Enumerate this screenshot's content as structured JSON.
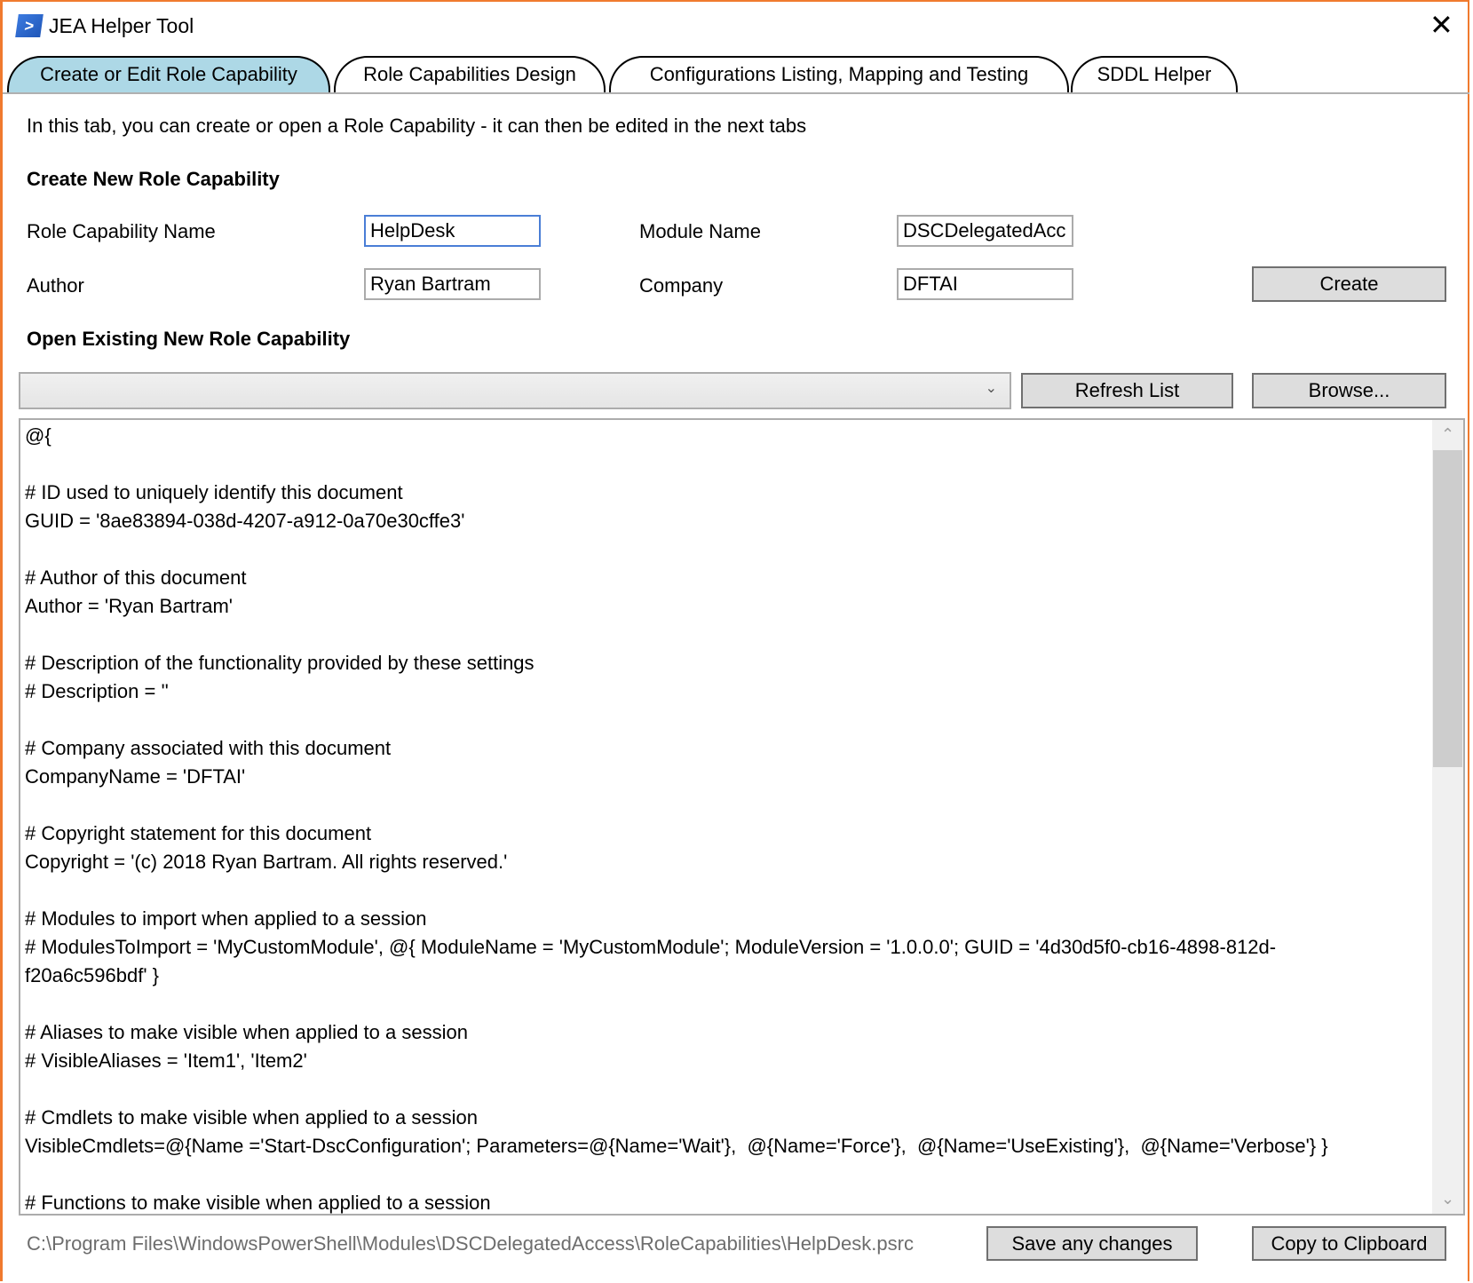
{
  "window": {
    "title": "JEA Helper Tool",
    "app_icon": "powershell-icon",
    "close_icon": "close-icon",
    "border_color": "#f07a2e"
  },
  "tabs": [
    {
      "label": "Create or Edit Role Capability",
      "active": true
    },
    {
      "label": "Role Capabilities Design",
      "active": false
    },
    {
      "label": "Configurations Listing, Mapping and Testing",
      "active": false
    },
    {
      "label": "SDDL Helper",
      "active": false
    }
  ],
  "active_tab_color": "#add8e6",
  "intro": "In this tab, you can create or open a Role Capability - it can then be edited in the next tabs",
  "create_section": {
    "heading": "Create New Role Capability",
    "role_name_label": "Role Capability Name",
    "role_name_value": "HelpDesk",
    "module_label": "Module Name",
    "module_value": "DSCDelegatedAcc",
    "author_label": "Author",
    "author_value": "Ryan Bartram",
    "company_label": "Company",
    "company_value": "DFTAI",
    "create_button": "Create"
  },
  "open_section": {
    "heading": "Open Existing New Role Capability",
    "dropdown_value": "",
    "refresh_button": "Refresh List",
    "browse_button": "Browse..."
  },
  "editor": {
    "lines": [
      "@{",
      "",
      "# ID used to uniquely identify this document",
      "GUID = '8ae83894-038d-4207-a912-0a70e30cffe3'",
      "",
      "# Author of this document",
      "Author = 'Ryan Bartram'",
      "",
      "# Description of the functionality provided by these settings",
      "# Description = ''",
      "",
      "# Company associated with this document",
      "CompanyName = 'DFTAI'",
      "",
      "# Copyright statement for this document",
      "Copyright = '(c) 2018 Ryan Bartram. All rights reserved.'",
      "",
      "# Modules to import when applied to a session",
      "# ModulesToImport = 'MyCustomModule', @{ ModuleName = 'MyCustomModule'; ModuleVersion = '1.0.0.0'; GUID = '4d30d5f0-cb16-4898-812d-",
      "f20a6c596bdf' }",
      "",
      "# Aliases to make visible when applied to a session",
      "# VisibleAliases = 'Item1', 'Item2'",
      "",
      "# Cmdlets to make visible when applied to a session",
      "VisibleCmdlets=@{Name ='Start-DscConfiguration'; Parameters=@{Name='Wait'},  @{Name='Force'},  @{Name='UseExisting'},  @{Name='Verbose'} }",
      "",
      "# Functions to make visible when applied to a session"
    ]
  },
  "footer": {
    "file_path": "C:\\Program Files\\WindowsPowerShell\\Modules\\DSCDelegatedAccess\\RoleCapabilities\\HelpDesk.psrc",
    "save_button": "Save any changes",
    "copy_button": "Copy to Clipboard"
  }
}
